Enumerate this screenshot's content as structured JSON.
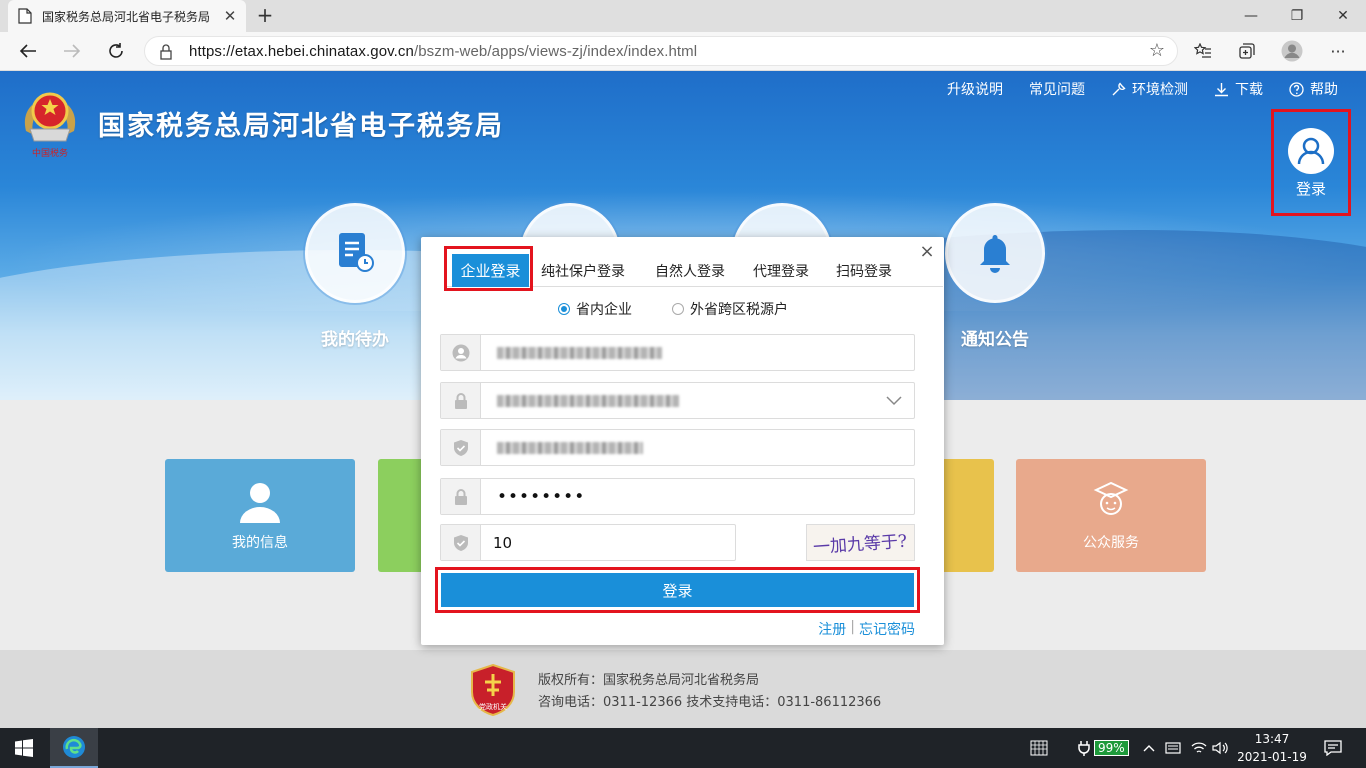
{
  "browser": {
    "tab_title": "国家税务总局河北省电子税务局",
    "tab_close": "✕",
    "new_tab": "+",
    "url_host": "https://etax.hebei.chinatax.gov.cn",
    "url_path": "/bszm-web/apps/views-zj/index/index.html",
    "window_controls": [
      "—",
      "❐",
      "✕"
    ]
  },
  "site": {
    "title": "国家税务总局河北省电子税务局",
    "emblem_caption": "中国税务",
    "topnav": [
      {
        "label": "升级说明",
        "icon": ""
      },
      {
        "label": "常见问题",
        "icon": ""
      },
      {
        "label": "环境检测",
        "icon": "wrench-icon"
      },
      {
        "label": "下载",
        "icon": "download-icon"
      },
      {
        "label": "帮助",
        "icon": "help-icon"
      }
    ],
    "login_corner_label": "登录",
    "functions": [
      {
        "label": "我的待办",
        "icon": "todo-doc-icon"
      },
      {
        "label": "",
        "icon": "calendar-icon"
      },
      {
        "label": "",
        "icon": "grid-icon"
      },
      {
        "label": "通知公告",
        "icon": "bell-icon"
      }
    ],
    "cards": [
      {
        "label": "我的信息",
        "color": "#5aaad8",
        "icon": "user-icon"
      },
      {
        "label": "",
        "color": "#8ccf5e",
        "icon": ""
      },
      {
        "label": "",
        "color": "#e8c24c",
        "icon": ""
      },
      {
        "label": "公众服务",
        "color": "#e8a98c",
        "icon": "service-person-icon"
      }
    ],
    "footer": {
      "badge_caption": "党政机关",
      "copyright": "版权所有：国家税务总局河北省税务局",
      "contact": "咨询电话：0311-12366  技术支持电话：0311-86112366"
    }
  },
  "modal": {
    "close": "×",
    "tabs": [
      "企业登录",
      "纯社保户登录",
      "自然人登录",
      "代理登录",
      "扫码登录"
    ],
    "active_tab": "企业登录",
    "radios": [
      {
        "label": "省内企业",
        "checked": true
      },
      {
        "label": "外省跨区税源户",
        "checked": false
      }
    ],
    "password_mask": "••••••••",
    "captcha_value": "10",
    "captcha_image_text": "一加九等于?",
    "submit_label": "登录",
    "links": {
      "register": "注册",
      "separator": "|",
      "forgot": "忘记密码"
    }
  },
  "taskbar": {
    "battery": "99%",
    "time": "13:47",
    "date": "2021-01-19"
  },
  "colors": {
    "accent": "#1a8fd9",
    "highlight_red": "#e3141e"
  }
}
